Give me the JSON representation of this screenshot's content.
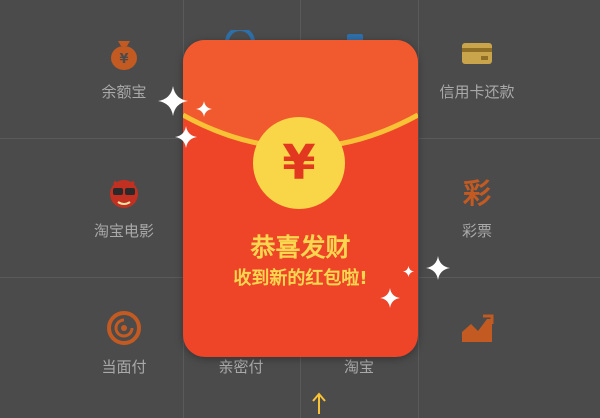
{
  "grid": {
    "cells": [
      {
        "label": "余额宝",
        "icon": "money-bag-icon"
      },
      {
        "label": "信用卡还款",
        "icon": "credit-card-icon"
      },
      {
        "label": "淘宝电影",
        "icon": "movie-mascot-icon"
      },
      {
        "label": "彩票",
        "icon": "lottery-icon"
      },
      {
        "label": "当面付",
        "icon": "face-pay-icon"
      },
      {
        "label": "亲密付",
        "icon": "intimate-pay-icon"
      },
      {
        "label": "淘宝",
        "icon": "taobao-icon"
      },
      {
        "label": "",
        "icon": "stock-chart-icon"
      }
    ]
  },
  "red_packet": {
    "currency_symbol": "¥",
    "title": "恭喜发财",
    "subtitle": "收到新的红包啦!",
    "color": "#ee4428",
    "accent": "#f9d548"
  },
  "colors": {
    "background": "#4b4b4b",
    "icon_orange": "#c25a22",
    "label_gray": "#a9a9a9"
  }
}
